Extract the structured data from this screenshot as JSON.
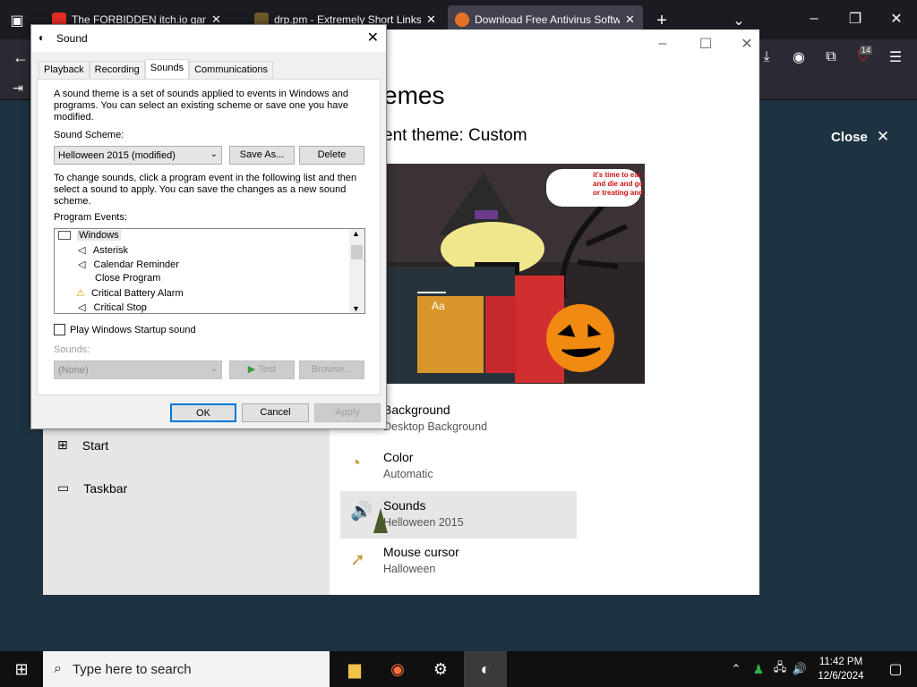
{
  "browser": {
    "tabs": [
      {
        "label": "The FORBIDDEN itch.io games",
        "favicon_color": "#e52d27"
      },
      {
        "label": "drp.pm - Extremely Short Links",
        "favicon_color": "#6b5a2a"
      },
      {
        "label": "Download Free Antivirus Softw",
        "favicon_color": "#e8712a"
      }
    ],
    "new_tab_icon": "plus-icon",
    "download_badge": "14"
  },
  "page": {
    "close_label": "Close"
  },
  "settings": {
    "title": "emes",
    "subtitle": "ent theme: Custom",
    "preview": {
      "speech": "it's time to eat shit and die and go trick or treating and eatin!",
      "tile_label": "Aa"
    },
    "options": [
      {
        "title": "Background",
        "value": "Desktop Background",
        "icon": "picture-icon"
      },
      {
        "title": "Color",
        "value": "Automatic",
        "icon": "palette-icon"
      },
      {
        "title": "Sounds",
        "value": "Helloween 2015",
        "icon": "speaker-icon"
      },
      {
        "title": "Mouse cursor",
        "value": "Halloween",
        "icon": "cursor-icon"
      }
    ],
    "nav": [
      {
        "label": "Start",
        "icon": "start-icon"
      },
      {
        "label": "Taskbar",
        "icon": "taskbar-icon"
      }
    ]
  },
  "dialog": {
    "title": "Sound",
    "tabs": [
      "Playback",
      "Recording",
      "Sounds",
      "Communications"
    ],
    "active_tab": "Sounds",
    "intro": "A sound theme is a set of sounds applied to events in Windows and programs.  You can select an existing scheme or save one you have modified.",
    "scheme_label": "Sound Scheme:",
    "scheme_value": "Helloween 2015 (modified)",
    "save_as": "Save As...",
    "delete": "Delete",
    "instructions": "To change sounds, click a program event in the following list and then select a sound to apply.  You can save the changes as a new sound scheme.",
    "events_label": "Program Events:",
    "events": [
      "Windows",
      "Asterisk",
      "Calendar Reminder",
      "Close Program",
      "Critical Battery Alarm",
      "Critical Stop"
    ],
    "startup_label": "Play Windows Startup sound",
    "sounds_label": "Sounds:",
    "sounds_value": "(None)",
    "test": "Test",
    "browse": "Browse...",
    "ok": "OK",
    "cancel": "Cancel",
    "apply": "Apply"
  },
  "taskbar": {
    "search_placeholder": "Type here to search",
    "time": "11:42 PM",
    "date": "12/6/2024"
  }
}
